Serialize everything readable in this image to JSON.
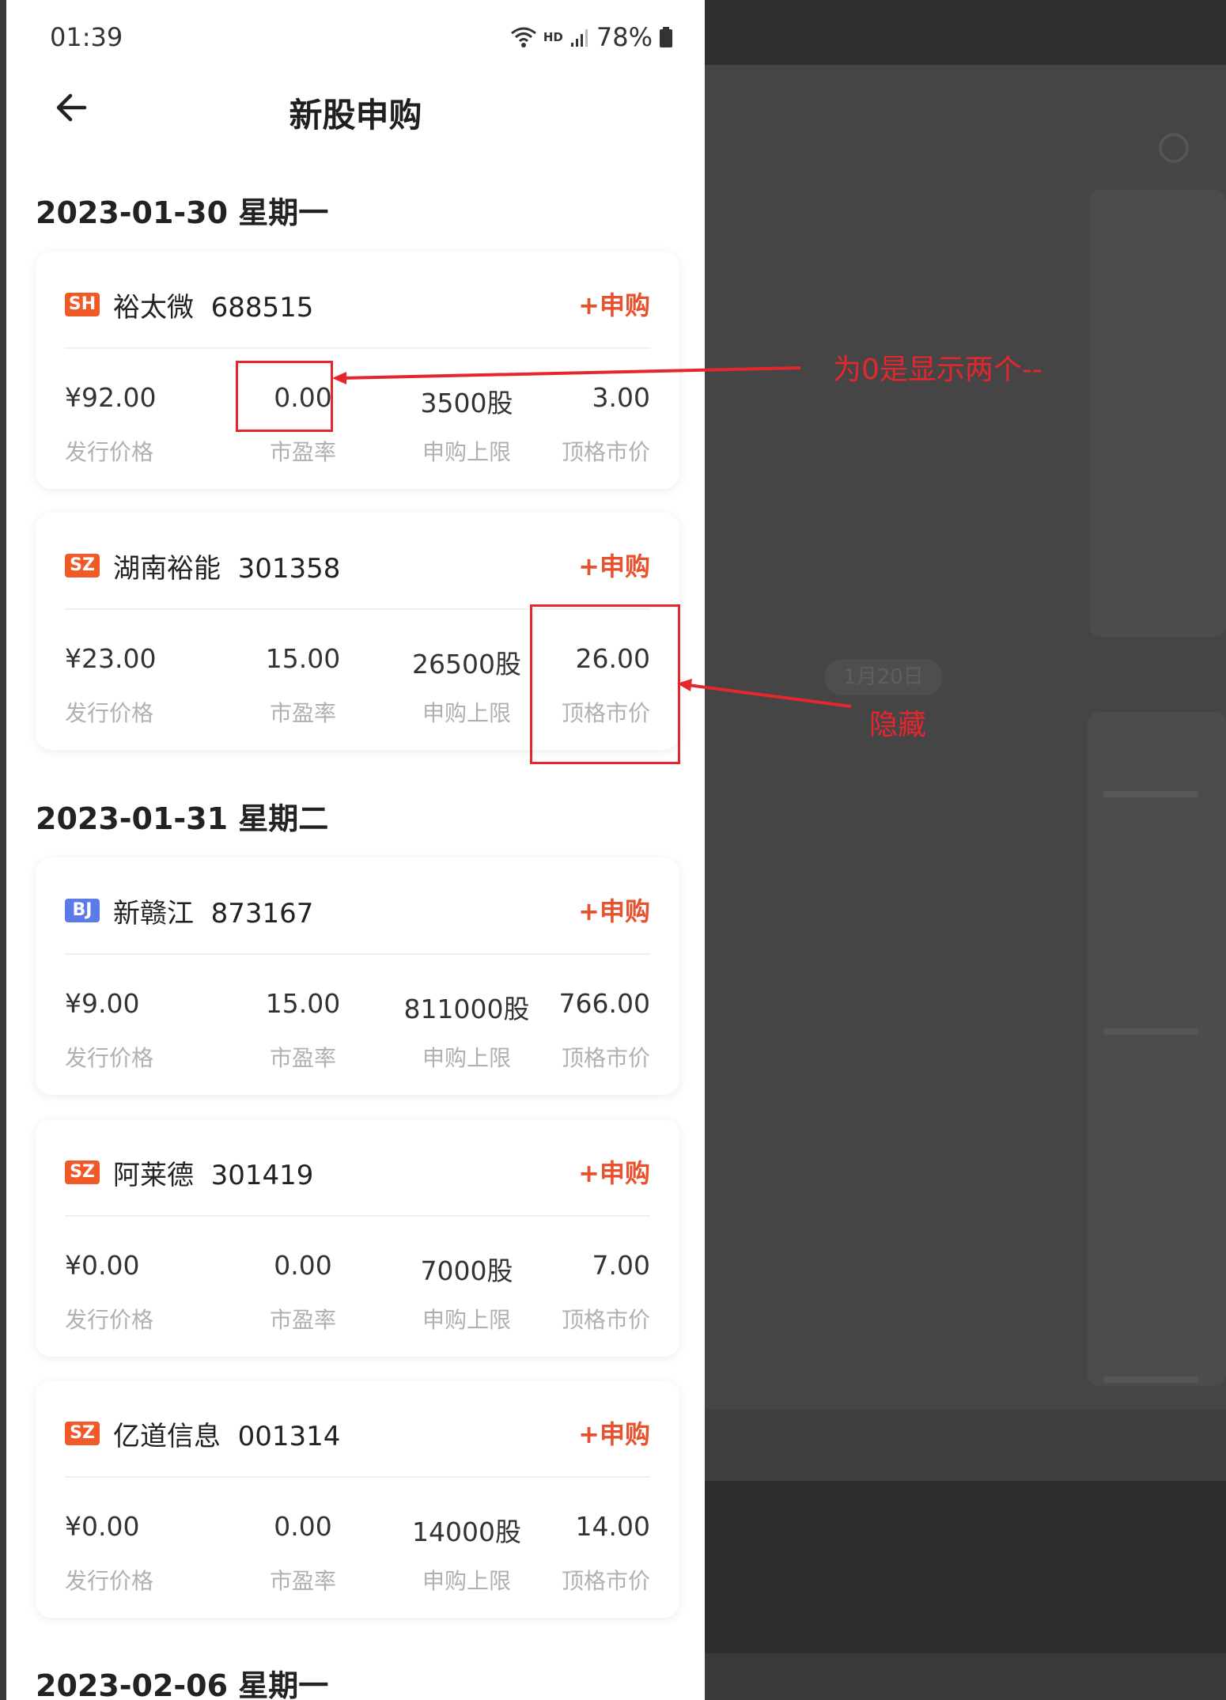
{
  "status_bar": {
    "time": "01:39",
    "network": "HD",
    "battery": "78%"
  },
  "header": {
    "title": "新股申购"
  },
  "sections": [
    {
      "date": "2023-01-30 星期一",
      "items": [
        {
          "exchange": "SH",
          "exchange_color": "#f05a29",
          "name": "裕太微",
          "code": "688515",
          "action": "+申购",
          "price": "¥92.00",
          "pe": "0.00",
          "limit": "3500股",
          "top_mv": "3.00"
        },
        {
          "exchange": "SZ",
          "exchange_color": "#f05a29",
          "name": "湖南裕能",
          "code": "301358",
          "action": "+申购",
          "price": "¥23.00",
          "pe": "15.00",
          "limit": "26500股",
          "top_mv": "26.00"
        }
      ]
    },
    {
      "date": "2023-01-31 星期二",
      "items": [
        {
          "exchange": "BJ",
          "exchange_color": "#5b7be9",
          "name": "新赣江",
          "code": "873167",
          "action": "+申购",
          "price": "¥9.00",
          "pe": "15.00",
          "limit": "811000股",
          "top_mv": "766.00"
        },
        {
          "exchange": "SZ",
          "exchange_color": "#f05a29",
          "name": "阿莱德",
          "code": "301419",
          "action": "+申购",
          "price": "¥0.00",
          "pe": "0.00",
          "limit": "7000股",
          "top_mv": "7.00"
        },
        {
          "exchange": "SZ",
          "exchange_color": "#f05a29",
          "name": "亿道信息",
          "code": "001314",
          "action": "+申购",
          "price": "¥0.00",
          "pe": "0.00",
          "limit": "14000股",
          "top_mv": "14.00"
        }
      ]
    },
    {
      "date": "2023-02-06 星期一",
      "items": []
    }
  ],
  "labels": {
    "price": "发行价格",
    "pe": "市盈率",
    "limit": "申购上限",
    "top_mv": "顶格市价"
  },
  "annotations": {
    "zero_note": "为0是显示两个--",
    "hide_note": "隐藏"
  },
  "background": {
    "date_pill": "1月20日"
  },
  "colors": {
    "accent": "#e9512e",
    "annotation": "#e6262d"
  }
}
